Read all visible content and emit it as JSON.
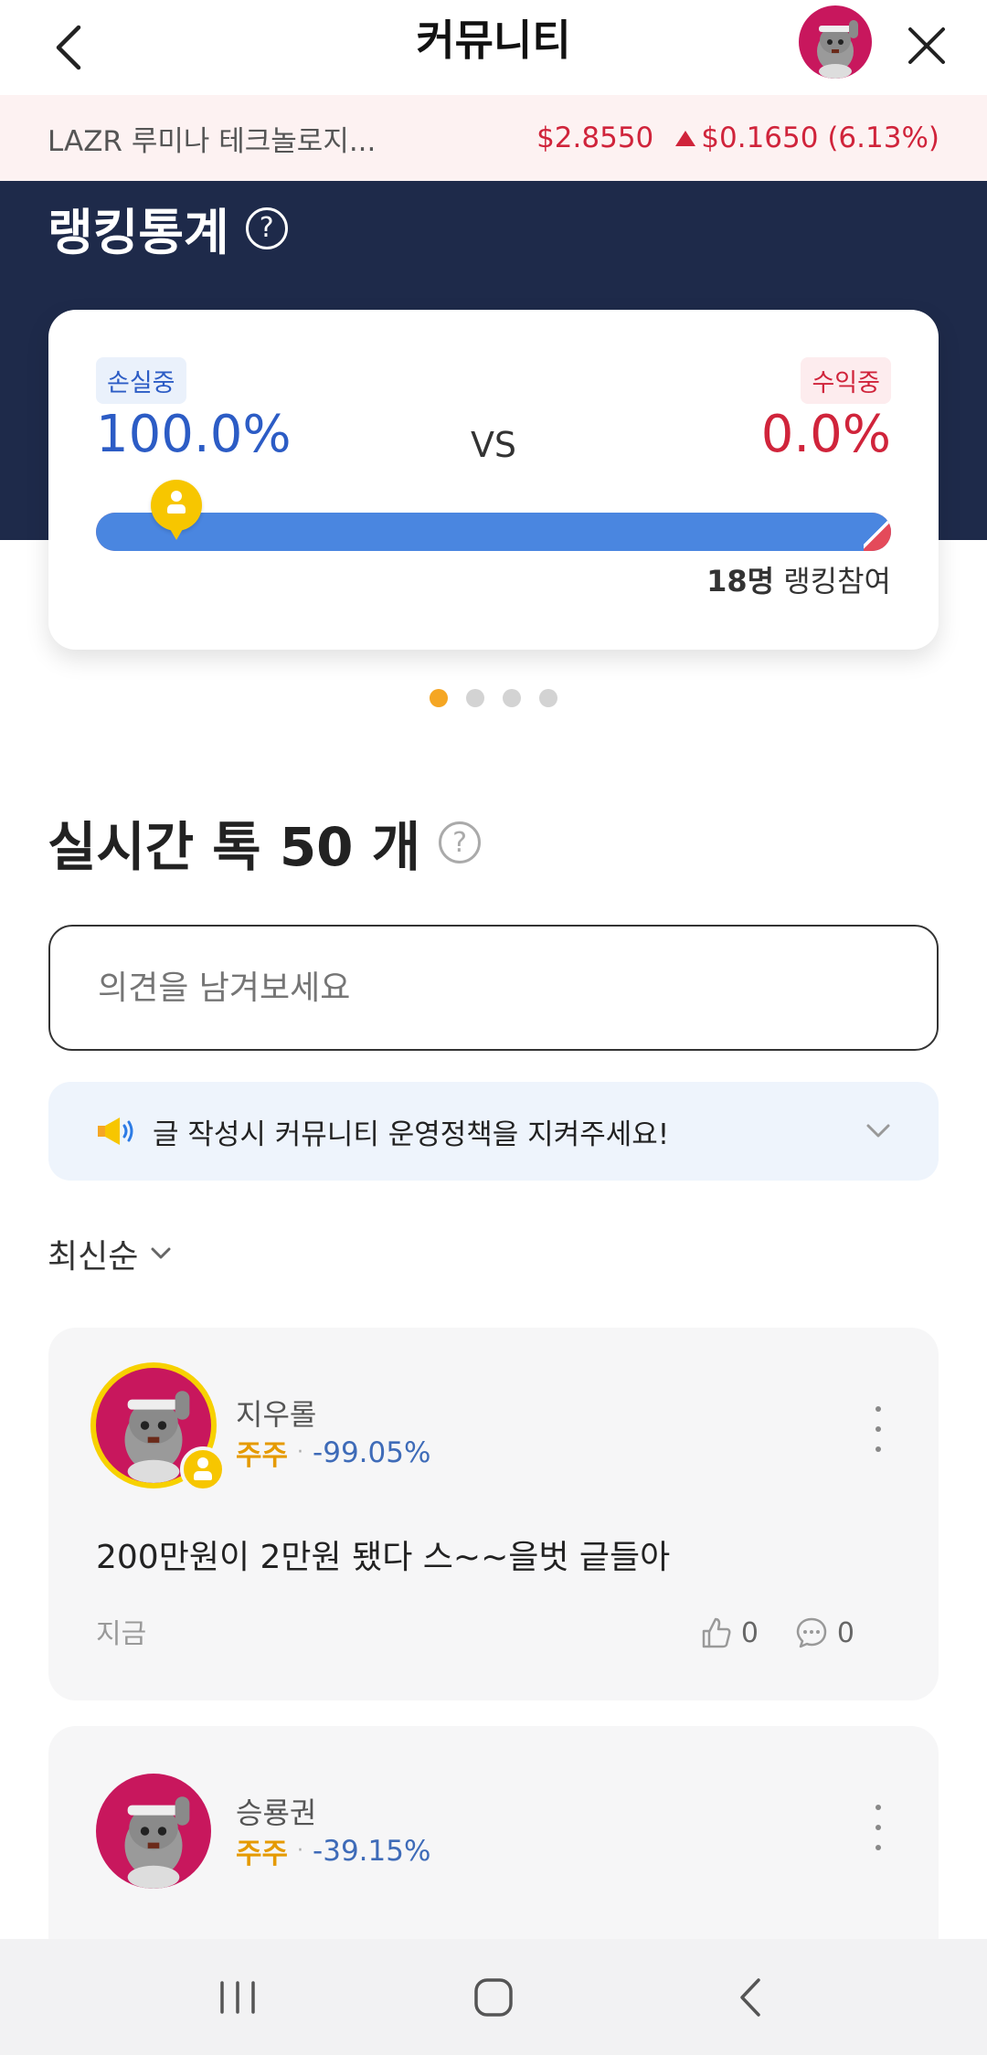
{
  "header": {
    "title": "커뮤니티"
  },
  "ticker": {
    "name": "LAZR 루미나 테크놀로지...",
    "price": "$2.8550",
    "change": "$0.1650 (6.13%)",
    "up_color": "#d0243b"
  },
  "ranking": {
    "title": "랭킹통계",
    "help_glyph": "?",
    "loss_label": "손실중",
    "loss_pct": "100.0%",
    "loss_fraction": 1.0,
    "vs": "VS",
    "profit_label": "수익중",
    "profit_pct": "0.0%",
    "participants_count": "18명",
    "participants_suffix": " 랭킹참여",
    "carousel_pages": 4,
    "carousel_active": 0
  },
  "live": {
    "title": "실시간 톡 50 개",
    "help_glyph": "?",
    "input_placeholder": "의견을 남겨보세요",
    "policy_notice": "글 작성시 커뮤니티 운영정책을 지켜주세요!",
    "sort_label": "최신순"
  },
  "posts": [
    {
      "user": "지우롤",
      "grade": "주주",
      "separator": "·",
      "return": "-99.05%",
      "content": "200만원이 2만원 됐다 스~~을벗 긑들아",
      "time": "지금",
      "likes": "0",
      "comments": "0"
    },
    {
      "user": "승룡권",
      "grade": "주주",
      "separator": "·",
      "return": "-39.15%"
    }
  ],
  "colors": {
    "navy": "#1e2a4a",
    "loss_blue": "#2c5cc5",
    "profit_red": "#d0243b",
    "accent_yellow": "#f7c600",
    "avatar_magenta": "#c8175d"
  }
}
